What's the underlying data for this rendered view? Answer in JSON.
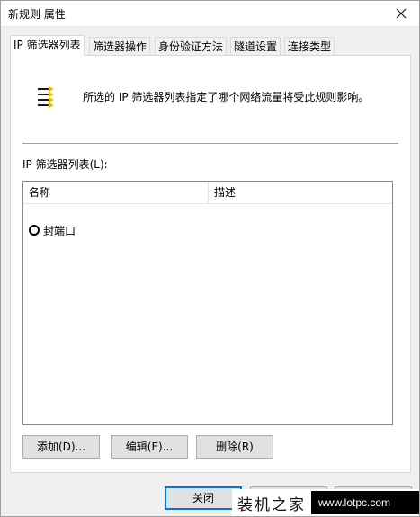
{
  "window": {
    "title": "新规则 属性"
  },
  "tabs": [
    {
      "label": "IP 筛选器列表",
      "active": true
    },
    {
      "label": "筛选器操作",
      "active": false
    },
    {
      "label": "身份验证方法",
      "active": false
    },
    {
      "label": "隧道设置",
      "active": false
    },
    {
      "label": "连接类型",
      "active": false
    }
  ],
  "panel": {
    "icon": "ip-filter-list-icon",
    "description": "所选的 IP 筛选器列表指定了哪个网络流量将受此规则影响。",
    "list_label": "IP 筛选器列表(L):",
    "columns": [
      "名称",
      "描述"
    ],
    "rows": [
      {
        "name": "封端口",
        "description": "",
        "selected": false
      }
    ]
  },
  "buttons": {
    "add": "添加(D)...",
    "edit": "编辑(E)...",
    "delete": "删除(R)",
    "close": "关闭"
  },
  "watermark": {
    "cn": "装机之家",
    "url": "www.lotpc.com"
  }
}
